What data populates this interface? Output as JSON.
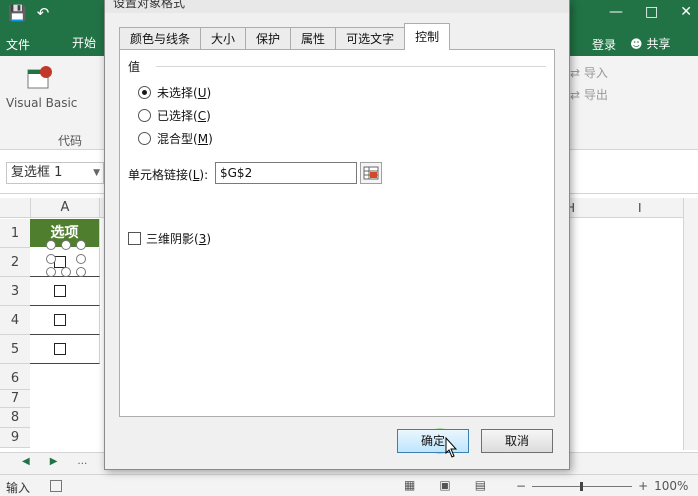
{
  "excel": {
    "tab_file": "文件",
    "tab_home": "开始",
    "signin": "登录",
    "share": "共享",
    "ribbon": {
      "visual_basic": "Visual Basic",
      "group_code": "代码",
      "import": "导入",
      "export": "导出"
    },
    "name_box": "复选框 1",
    "columns": {
      "A": "A",
      "H": "H",
      "I": "I"
    },
    "rows": [
      "1",
      "2",
      "3",
      "4",
      "5",
      "6",
      "7",
      "8",
      "9"
    ],
    "header_cell": "选项",
    "status_mode": "输入",
    "zoom": "100%"
  },
  "dialog": {
    "title": "设置对象格式",
    "tabs": [
      "颜色与线条",
      "大小",
      "保护",
      "属性",
      "可选文字",
      "控制"
    ],
    "active_tab_index": 5,
    "value_section": "值",
    "radios": [
      {
        "label": "未选择",
        "key": "U",
        "checked": true
      },
      {
        "label": "已选择",
        "key": "C",
        "checked": false
      },
      {
        "label": "混合型",
        "key": "M",
        "checked": false
      }
    ],
    "cell_link_label": "单元格链接",
    "cell_link_key": "L",
    "cell_link_value": "$G$2",
    "shading_label": "三维阴影",
    "shading_key": "3",
    "shading_checked": false,
    "ok": "确定",
    "cancel": "取消"
  },
  "colors": {
    "excel_green": "#217346",
    "header_fill": "#4f7f2e"
  }
}
